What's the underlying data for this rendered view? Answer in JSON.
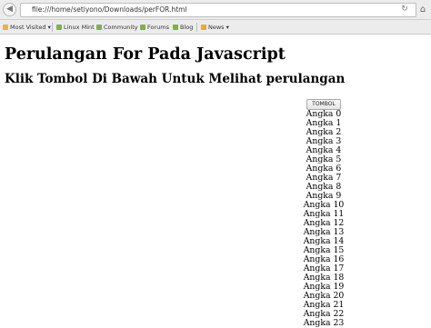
{
  "browser": {
    "url": "file:///home/setiyono/Downloads/perFOR.html",
    "bookmarks": [
      {
        "label": "Most Visited ▾",
        "icon": "folder-icon"
      },
      {
        "label": "Linux Mint",
        "icon": "mint-icon"
      },
      {
        "label": "Community",
        "icon": "mint-icon"
      },
      {
        "label": "Forums",
        "icon": "mint-icon"
      },
      {
        "label": "Blog",
        "icon": "mint-icon"
      },
      {
        "label": "News ▾",
        "icon": "rss-icon"
      }
    ]
  },
  "page": {
    "heading": "Perulangan For Pada Javascript",
    "subheading": "Klik Tombol Di Bawah Untuk Melihat perulangan",
    "button_label": "TOMBOL",
    "output_lines": [
      "Angka 0",
      "Angka 1",
      "Angka 2",
      "Angka 3",
      "Angka 4",
      "Angka 5",
      "Angka 6",
      "Angka 7",
      "Angka 8",
      "Angka 9",
      "Angka 10",
      "Angka 11",
      "Angka 12",
      "Angka 13",
      "Angka 14",
      "Angka 15",
      "Angka 16",
      "Angka 17",
      "Angka 18",
      "Angka 19",
      "Angka 20",
      "Angka 21",
      "Angka 22",
      "Angka 23"
    ]
  },
  "colors": {
    "chrome": "#ececec",
    "mint": "#7cb342",
    "rss": "#f5a623",
    "folder": "#e8b14a"
  }
}
